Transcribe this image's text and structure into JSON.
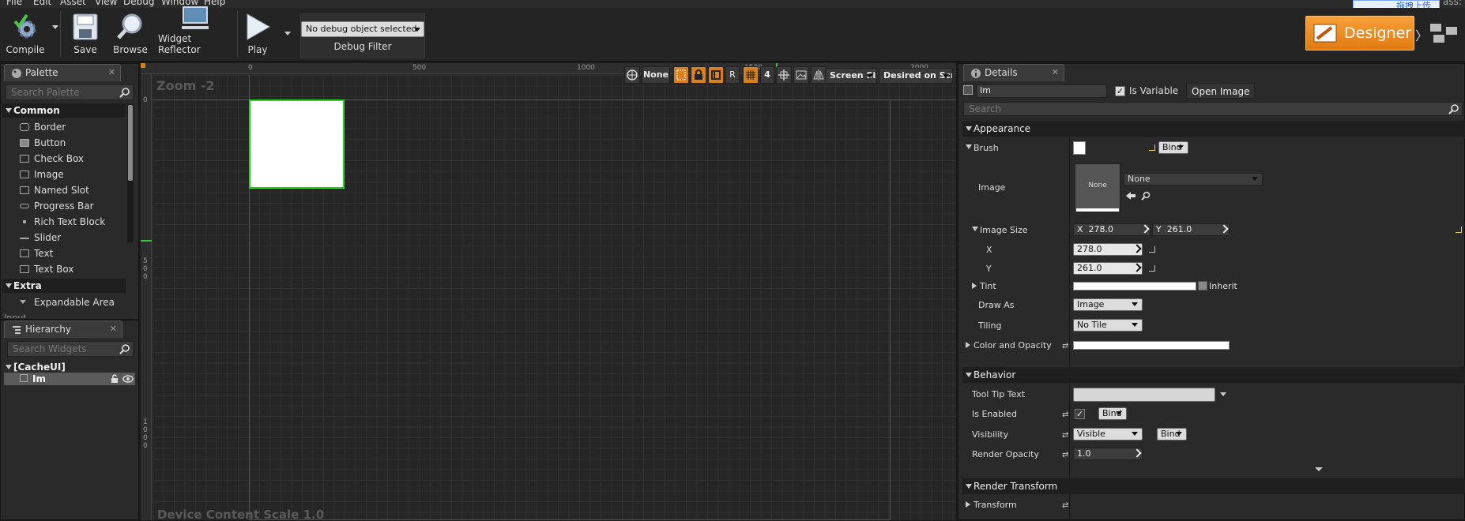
{
  "menu": [
    "File",
    "Edit",
    "Asset",
    "View",
    "Debug",
    "Window",
    "Help"
  ],
  "overlay_upload": "拖拽上传",
  "overlay_right": "ass:",
  "toolbar": {
    "compile": "Compile",
    "save": "Save",
    "browse": "Browse",
    "widget_reflector": "Widget Reflector",
    "play": "Play",
    "debug_combo": "No debug object selected",
    "debug_filter": "Debug Filter",
    "designer": "Designer"
  },
  "palette": {
    "tab": "Palette",
    "search_placeholder": "Search Palette",
    "categories": [
      {
        "name": "Common",
        "items": [
          "Border",
          "Button",
          "Check Box",
          "Image",
          "Named Slot",
          "Progress Bar",
          "Rich Text Block",
          "Slider",
          "Text",
          "Text Box"
        ]
      },
      {
        "name": "Extra",
        "items": [
          "Expandable Area"
        ]
      }
    ],
    "cut_off": "Input"
  },
  "hierarchy": {
    "tab": "Hierarchy",
    "search_placeholder": "Search Widgets",
    "root": "[CacheUI]",
    "child": "Im"
  },
  "canvas": {
    "zoom": "Zoom -2",
    "bottom_label": "Device Content Scale 1.0",
    "ruler_top": [
      "0",
      "500",
      "1000",
      "1500",
      "2000"
    ],
    "ruler_left": [
      "0",
      "500",
      "1000"
    ],
    "toolbar": {
      "none": "None",
      "r": "R",
      "grid_num": "4",
      "screen_size": "Screen Size",
      "desired": "Desired on Screen"
    }
  },
  "details": {
    "tab": "Details",
    "name_value": "Im",
    "is_variable": "Is Variable",
    "open_image": "Open Image",
    "search_placeholder": "Search",
    "sections": {
      "appearance": "Appearance",
      "behavior": "Behavior",
      "render_transform": "Render Transform"
    },
    "labels": {
      "brush": "Brush",
      "image": "Image",
      "image_size": "Image Size",
      "x": "X",
      "y": "Y",
      "tint": "Tint",
      "draw_as": "Draw As",
      "tiling": "Tiling",
      "color_opacity": "Color and Opacity",
      "tooltip": "Tool Tip Text",
      "is_enabled": "Is Enabled",
      "visibility": "Visibility",
      "render_opacity": "Render Opacity",
      "transform": "Transform",
      "inherit": "Inherit",
      "bind": "Bind"
    },
    "values": {
      "image_none": "None",
      "image_combo": "None",
      "size_x": "278.0",
      "size_y": "261.0",
      "x_prefix": "X",
      "y_prefix": "Y",
      "draw_as": "Image",
      "tiling": "No Tile",
      "visibility": "Visible",
      "render_opacity": "1.0"
    }
  }
}
